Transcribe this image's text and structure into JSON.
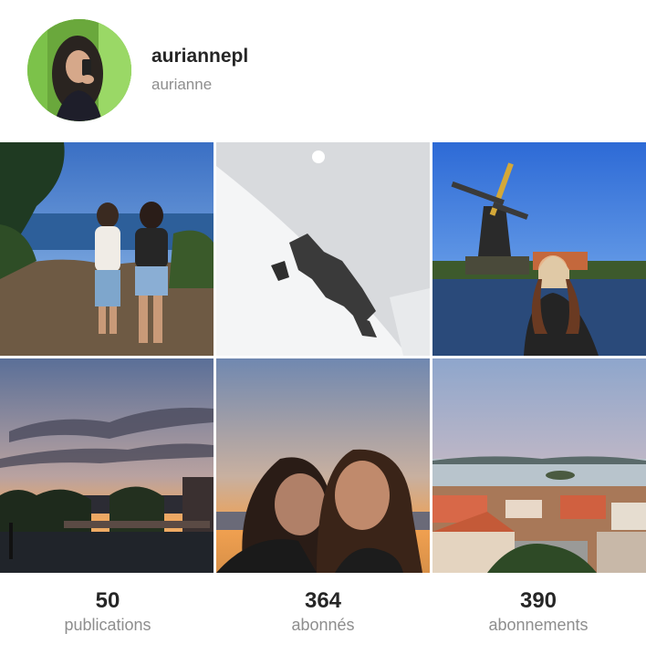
{
  "profile": {
    "username": "auriannepl",
    "full_name": "aurianne"
  },
  "posts": [
    {
      "subject": "two-friends-coast"
    },
    {
      "subject": "snowy-mountain"
    },
    {
      "subject": "windmill-canal"
    },
    {
      "subject": "sunset-terrace"
    },
    {
      "subject": "sunset-selfie"
    },
    {
      "subject": "harbor-town"
    }
  ],
  "stats": {
    "publications": {
      "count": "50",
      "label": "publications"
    },
    "followers": {
      "count": "364",
      "label": "abonnés"
    },
    "following": {
      "count": "390",
      "label": "abonnements"
    }
  },
  "colors": {
    "accent_green": "#7cc24a",
    "text_primary": "#262626",
    "text_secondary": "#8e8e8e"
  }
}
